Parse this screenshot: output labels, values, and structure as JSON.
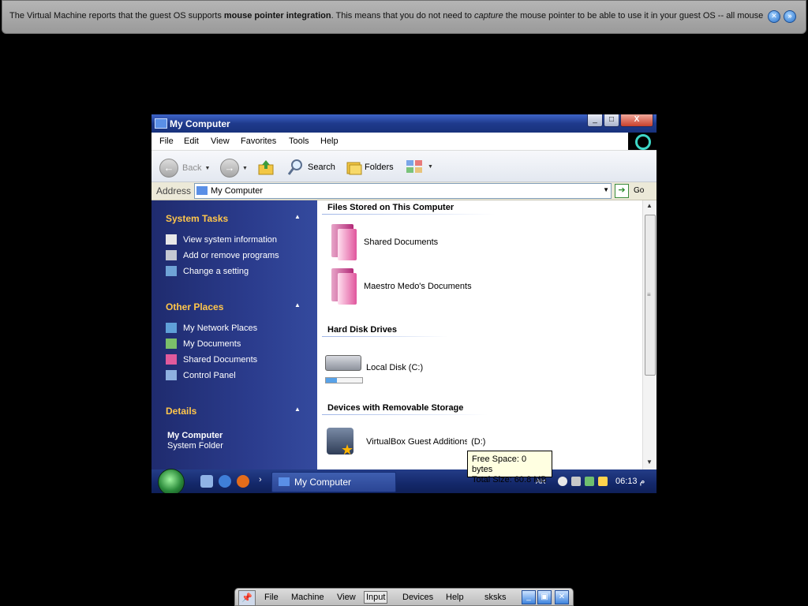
{
  "notification": {
    "part1": "The Virtual Machine reports that the guest OS supports ",
    "bold": "mouse pointer integration",
    "part2": ". This means that you do not need to ",
    "italic": "capture",
    "part3": " the mouse pointer to be able to use it in your guest OS -- all mouse"
  },
  "window": {
    "title": "My Computer",
    "buttons": {
      "minimize": "_",
      "maximize": "□",
      "close": "X"
    }
  },
  "menu": [
    "File",
    "Edit",
    "View",
    "Favorites",
    "Tools",
    "Help"
  ],
  "toolbar": {
    "back": "Back",
    "search": "Search",
    "folders": "Folders"
  },
  "address": {
    "label": "Address",
    "value": "My Computer",
    "go": "Go"
  },
  "task_pane": {
    "system_tasks": {
      "title": "System Tasks",
      "items": [
        "View system information",
        "Add or remove programs",
        "Change a setting"
      ]
    },
    "other_places": {
      "title": "Other Places",
      "items": [
        "My Network Places",
        "My Documents",
        "Shared Documents",
        "Control Panel"
      ]
    },
    "details": {
      "title": "Details",
      "name": "My Computer",
      "type": "System Folder"
    }
  },
  "content": {
    "groups": [
      {
        "title": "Files Stored on This Computer",
        "items": [
          "Shared Documents",
          "Maestro Medo's Documents"
        ]
      },
      {
        "title": "Hard Disk Drives",
        "items": [
          "Local Disk (C:)"
        ]
      },
      {
        "title": "Devices with Removable Storage",
        "items": [
          "VirtualBox Guest Additions (D:)"
        ]
      }
    ],
    "local_disk_usage": 0.3
  },
  "tooltip": {
    "line1": "Free Space: 0 bytes",
    "line2": "Total Size: 60.8 MB"
  },
  "taskbar": {
    "task": "My Computer",
    "lang": "AR",
    "clock": "06:13 م"
  },
  "mini_toolbar": {
    "menus": [
      "File",
      "Machine",
      "View",
      "Input",
      "Devices",
      "Help"
    ],
    "vm_name": "sksks"
  },
  "colors": {
    "pane_header": "#ffc64b",
    "title_bar": "#1f3a8c",
    "accent": "#3ed7c7"
  }
}
